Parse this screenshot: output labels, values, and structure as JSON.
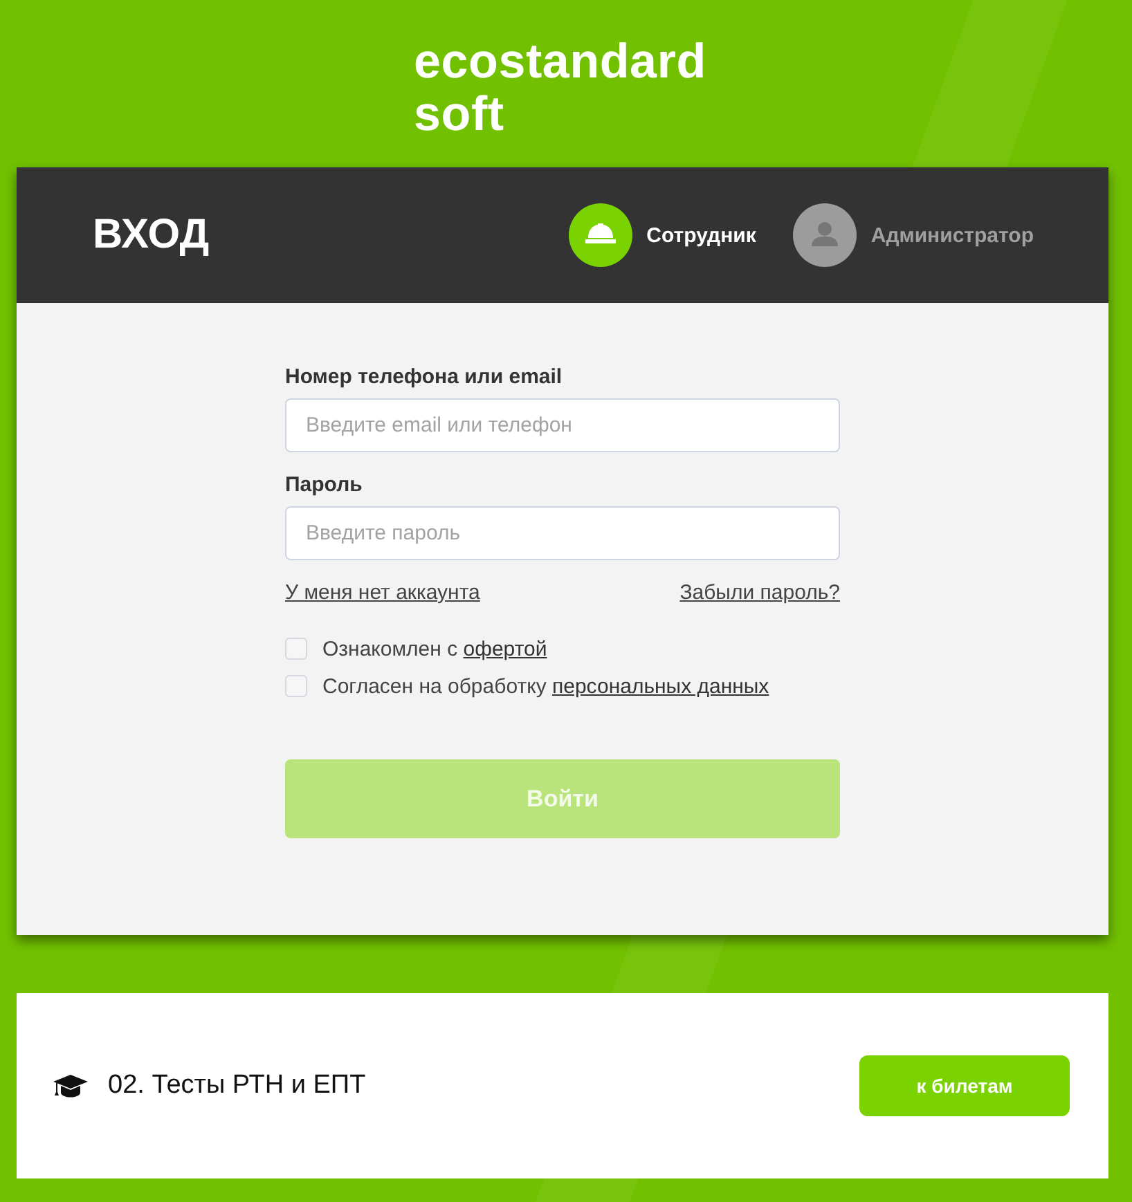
{
  "logo": {
    "line_1": "ecostandard",
    "line_2": "soft"
  },
  "login": {
    "title": "ВХОД",
    "roles": [
      {
        "label": "Сотрудник",
        "kind": "employee",
        "selected": true
      },
      {
        "label": "Администратор",
        "kind": "admin",
        "selected": false
      }
    ],
    "fields": [
      {
        "label": "Номер телефона или email",
        "placeholder": "Введите email или телефон"
      },
      {
        "label": "Пароль",
        "placeholder": "Введите пароль"
      }
    ],
    "links": [
      "У меня нет аккаунта",
      "Забыли пароль?"
    ],
    "agreements": [
      {
        "text": "Ознакомлен с",
        "link": "офертой",
        "checked": false
      },
      {
        "text": "Согласен на обработку",
        "link": "персональных данных",
        "checked": false
      }
    ],
    "submit": {
      "label": "Войти",
      "disabled": true
    }
  },
  "course": {
    "title": "02. Тесты РТН и ЕПТ",
    "button": "к билетам"
  }
}
